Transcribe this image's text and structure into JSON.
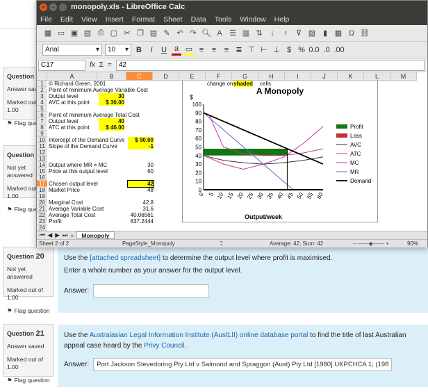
{
  "window": {
    "title": "monopoly.xls - LibreOffice Calc"
  },
  "menu": [
    "File",
    "Edit",
    "View",
    "Insert",
    "Format",
    "Sheet",
    "Data",
    "Tools",
    "Window",
    "Help"
  ],
  "format": {
    "font": "Arial",
    "size": "10"
  },
  "formula": {
    "cell": "C17",
    "value": "42"
  },
  "columns": [
    "A",
    "B",
    "C",
    "D",
    "E",
    "F",
    "G",
    "H",
    "I",
    "J",
    "K",
    "L",
    "M"
  ],
  "rows": [
    "1",
    "2",
    "3",
    "4",
    "5",
    "6",
    "7",
    "8",
    "9",
    "10",
    "11",
    "12",
    "13",
    "14",
    "15",
    "16",
    "17",
    "18",
    "19",
    "20",
    "21",
    "22",
    "23",
    "24",
    "25"
  ],
  "cells": {
    "r1a": "© Richard Green, 2001",
    "r1note1": "change only",
    "r1note2": "shaded",
    "r1note3": "cells",
    "r2a": "Point of minimum Average Variable Cost",
    "r3a": "Output level",
    "r3b": "30",
    "r4a": "AVC at this point",
    "r4b": "$   30.00",
    "r6a": "Point of minimum Average Total Cost",
    "r7a": "Output level",
    "r7b": "40",
    "r8a": "ATC at this point",
    "r8b": "$   40.00",
    "r10a": "Intercept of the Demand Curve",
    "r10c": "$  90.00",
    "r11a": "Slope of the Demand Curve",
    "r11c": "-1",
    "r14a": "Output where MR = MC",
    "r14c": "30",
    "r15a": "Price at this output level",
    "r15c": "60",
    "r17a": "Chosen output level",
    "r17c": "42",
    "r18a": "Market Price",
    "r18c": "48",
    "r20a": "Marginal Cost",
    "r20c": "42.8",
    "r21a": "Average Variable Cost",
    "r21c": "31.6",
    "r22a": "Average Total Cost",
    "r22c": "40.06561",
    "r23a": "Profit",
    "r23c": "837.2444"
  },
  "sheet_tab": "Monopoly",
  "status": {
    "sheet": "Sheet 2 of 2",
    "style": "PageStyle_Monopoly",
    "summary": "Average: 42; Sum: 42",
    "zoom": "90%"
  },
  "chart_data": {
    "type": "line",
    "title": "A Monopoly",
    "ylabel": "$",
    "xlabel": "Output/week",
    "xlim": [
      0,
      60
    ],
    "ylim": [
      0,
      100
    ],
    "xticks": [
      0,
      5,
      10,
      15,
      20,
      25,
      30,
      35,
      40,
      45,
      50,
      55,
      60
    ],
    "yticks": [
      0,
      10,
      20,
      30,
      40,
      50,
      60,
      70,
      80,
      90,
      100
    ],
    "legend": [
      "Profit",
      "Loss",
      "AVC",
      "ATC",
      "MC",
      "MR",
      "Demand"
    ],
    "legend_placement": "right",
    "series": [
      {
        "name": "AVC",
        "color": "#333333",
        "points": [
          [
            0,
            40
          ],
          [
            10,
            34.4
          ],
          [
            20,
            31.6
          ],
          [
            30,
            30
          ],
          [
            40,
            31.6
          ],
          [
            50,
            34.4
          ],
          [
            60,
            38.4
          ]
        ]
      },
      {
        "name": "ATC",
        "color": "#cc3399",
        "points": [
          [
            3,
            86
          ],
          [
            10,
            50
          ],
          [
            20,
            42
          ],
          [
            30,
            40
          ],
          [
            40,
            40
          ],
          [
            50,
            43
          ],
          [
            60,
            48
          ]
        ]
      },
      {
        "name": "MC",
        "color": "#cc3399",
        "points": [
          [
            0,
            40
          ],
          [
            10,
            30
          ],
          [
            20,
            24
          ],
          [
            30,
            30
          ],
          [
            40,
            38
          ],
          [
            50,
            54
          ],
          [
            60,
            74
          ]
        ]
      },
      {
        "name": "MR",
        "color": "#6666cc",
        "points": [
          [
            0,
            90
          ],
          [
            45,
            0
          ]
        ]
      },
      {
        "name": "Demand",
        "color": "#000000",
        "points": [
          [
            0,
            90
          ],
          [
            60,
            30
          ]
        ]
      }
    ],
    "profit_rect": {
      "x0": 0,
      "x1": 42,
      "y0": 40.07,
      "y1": 48,
      "color": "#117711"
    },
    "loss_color": "#bb3333",
    "vline_x": 42
  },
  "q20": {
    "label": "Question",
    "num": "20",
    "status": "Not yet answered",
    "marked": "Marked out of 1.00",
    "flag": "Flag question",
    "text_pre": "Use the",
    "text_link": "[attached spreadsheet]",
    "text_post": "to determine the output level where profit is maximised.",
    "text2": "Enter a whole number as your answer for the output level.",
    "answer_label": "Answer:",
    "answer_value": ""
  },
  "q21": {
    "label": "Question",
    "num": "21",
    "status": "Answer saved",
    "marked": "Marked out of 1.00",
    "flag": "Flag question",
    "text_pre": "Use the",
    "text_link": "Australasian Legal Information Institute (AustLII) online database portal",
    "text_mid": "to find the title of last Australian appeal case heard by the",
    "text_link2": "Privy Council",
    "answer_label": "Answer:",
    "answer_value": "Port Jackson Stevedoring Pty Ltd v Salmond and Spraggon (Aust) Pty Ltd [1980] UKPCHCA 1; (1980) 1"
  },
  "q18": {
    "label": "Question",
    "num": "18",
    "status": "Answer saved",
    "marked": "Marked out of 1.00",
    "flag": "Flag question"
  },
  "q19": {
    "label": "Question",
    "num": "19",
    "status": "Not yet answered",
    "marked": "Marked out of 1.00",
    "flag": "Flag question"
  }
}
